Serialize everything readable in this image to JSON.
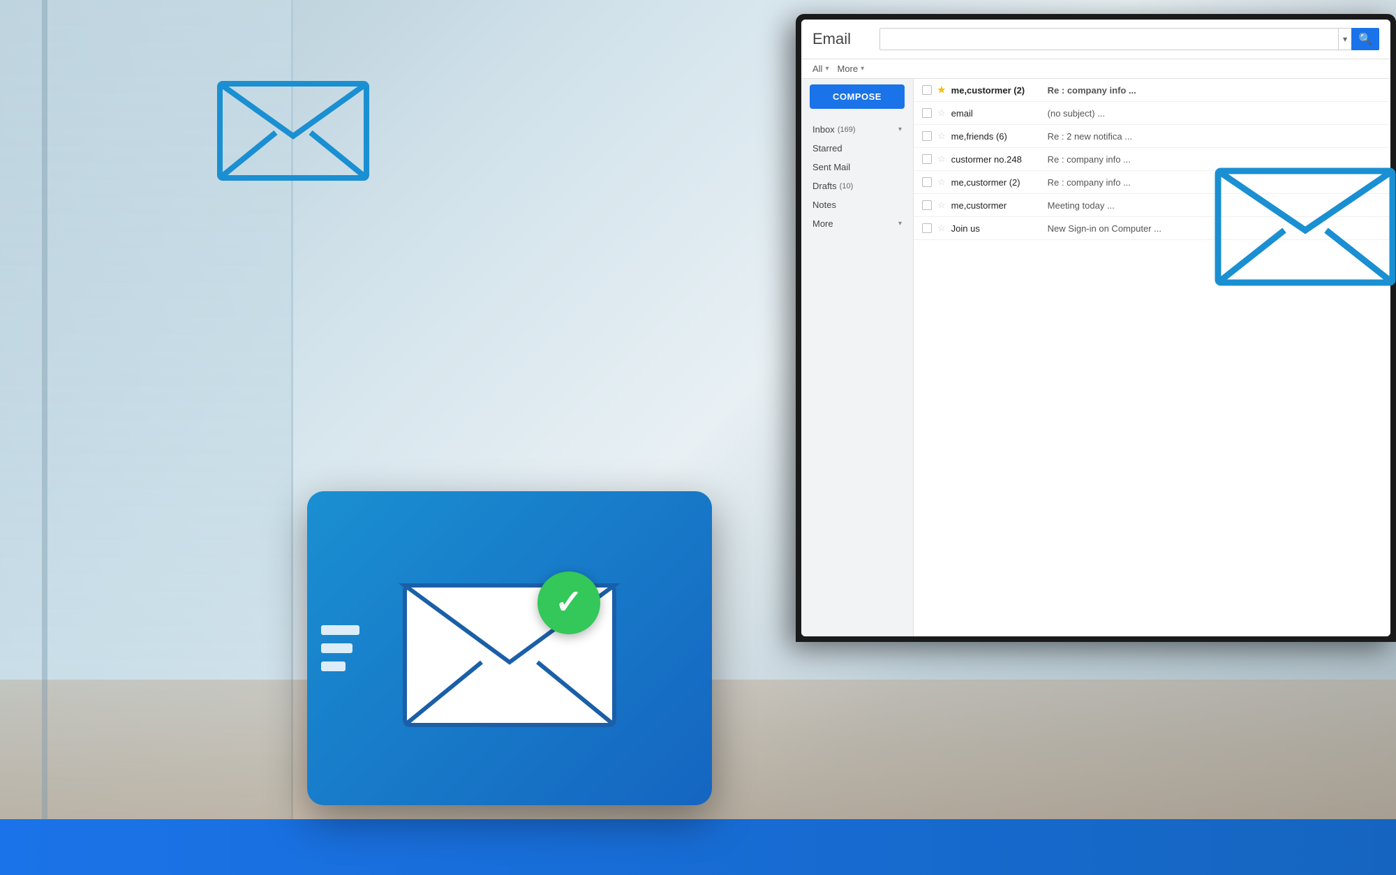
{
  "background": {
    "color_main": "#c8d8e0",
    "color_window": "rgba(200,220,230,0.6)"
  },
  "email_client": {
    "title": "Email",
    "search_placeholder": "",
    "search_dropdown_label": "▾",
    "search_btn_icon": "🔍",
    "toolbar": {
      "all_label": "All",
      "all_chevron": "▾",
      "more_label": "More",
      "more_chevron": "▾"
    },
    "sidebar": {
      "compose_label": "COMPOSE",
      "items": [
        {
          "label": "Inbox",
          "count": "(169)",
          "has_chevron": true
        },
        {
          "label": "Starred",
          "count": "",
          "has_chevron": false
        },
        {
          "label": "Sent Mail",
          "count": "",
          "has_chevron": false
        },
        {
          "label": "Drafts",
          "count": "(10)",
          "has_chevron": false
        },
        {
          "label": "Notes",
          "count": "",
          "has_chevron": false
        },
        {
          "label": "More",
          "count": "",
          "has_chevron": true
        }
      ]
    },
    "emails": [
      {
        "sender": "me,custormer (2)",
        "subject": "Re : company info ...",
        "starred": true,
        "unread": true
      },
      {
        "sender": "email",
        "subject": "(no subject) ...",
        "starred": false,
        "unread": false
      },
      {
        "sender": "me,friends (6)",
        "subject": "Re : 2 new notifica ...",
        "starred": false,
        "unread": false
      },
      {
        "sender": "custormer no.248",
        "subject": "Re : company info ...",
        "starred": false,
        "unread": false
      },
      {
        "sender": "me,custormer (2)",
        "subject": "Re : company info ...",
        "starred": false,
        "unread": false
      },
      {
        "sender": "me,custormer",
        "subject": "Meeting today ...",
        "starred": false,
        "unread": false
      },
      {
        "sender": "Join us",
        "subject": "New Sign-in on Computer ...",
        "starred": false,
        "unread": false
      }
    ]
  },
  "card": {
    "bg_color_start": "#1a8fd1",
    "bg_color_end": "#1565c0",
    "check_color": "#34c759",
    "checkmark": "✓"
  },
  "envelopes": {
    "outline_color": "#1a8fd1",
    "card_envelope_fill": "#ffffff",
    "card_envelope_stroke": "#1a5fa8"
  }
}
